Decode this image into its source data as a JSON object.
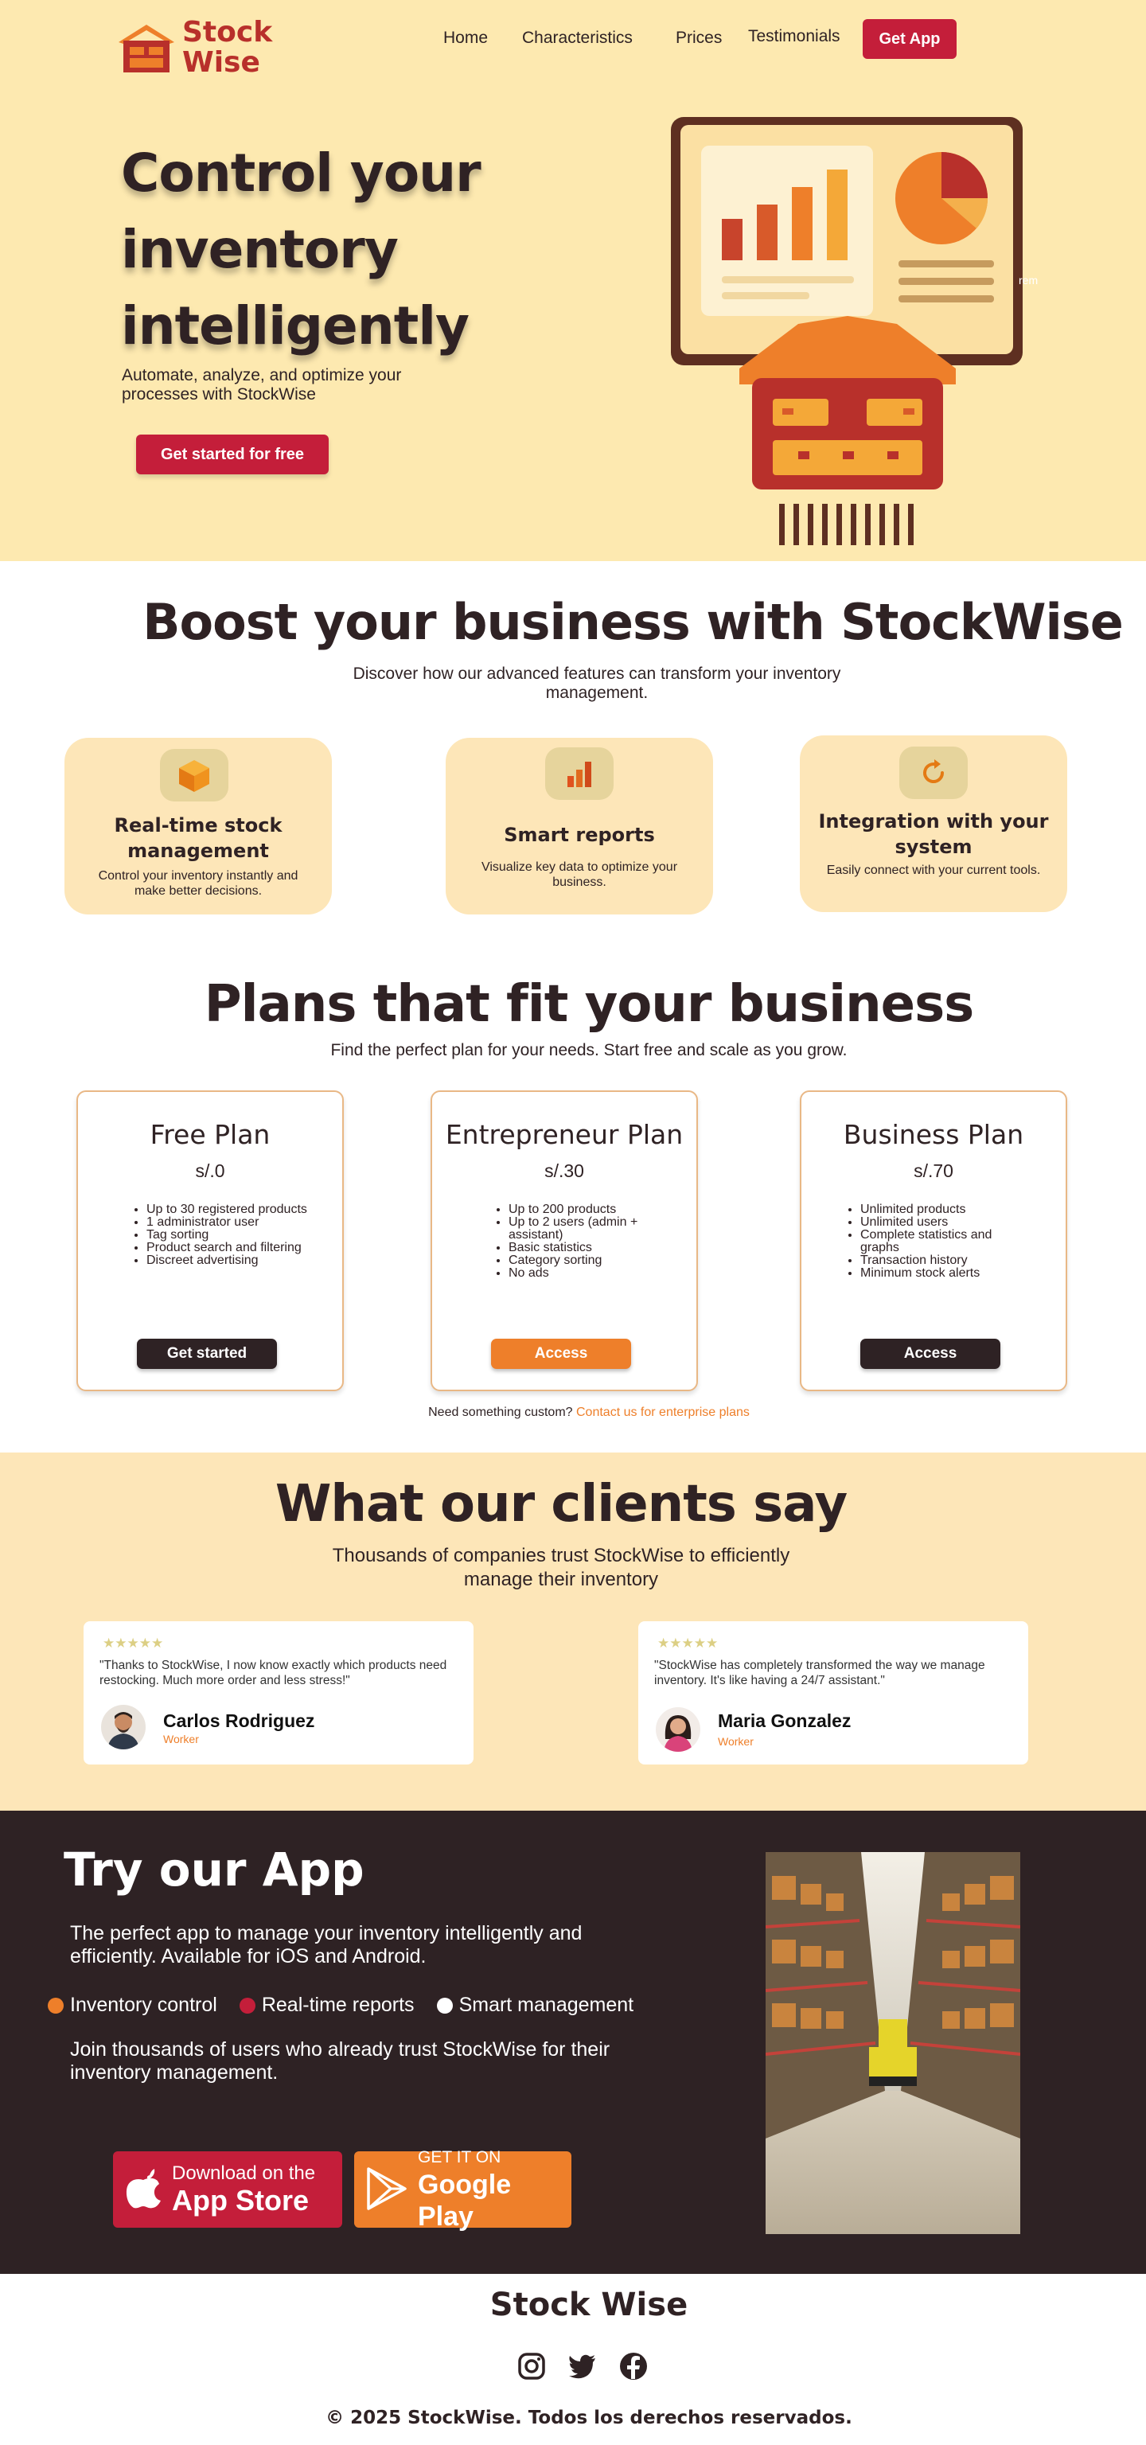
{
  "brand": {
    "name_line1": "Stock",
    "name_line2": "Wise"
  },
  "nav": {
    "home": "Home",
    "characteristics": "Characteristics",
    "prices": "Prices",
    "testimonials": "Testimonials",
    "get_app": "Get App"
  },
  "hero": {
    "title": "Control your inventory intelligently",
    "subtitle": "Automate, analyze, and optimize your processes with StockWise",
    "cta": "Get started for free",
    "caption": "rem"
  },
  "features": {
    "title": "Boost your business with StockWise",
    "subtitle": "Discover how our advanced features can transform your inventory management.",
    "items": [
      {
        "icon": "cube-icon",
        "title": "Real-time stock management",
        "desc": "Control your inventory instantly and make better decisions."
      },
      {
        "icon": "bar-chart-icon",
        "title": "Smart reports",
        "desc": "Visualize key data to optimize your business."
      },
      {
        "icon": "sync-icon",
        "title": "Integration with your system",
        "desc": "Easily connect with your current tools."
      }
    ]
  },
  "pricing": {
    "title": "Plans that fit your business",
    "subtitle": "Find the perfect plan for your needs. Start free and scale as you grow.",
    "plans": [
      {
        "name": "Free Plan",
        "price": "s/.0",
        "features": [
          "Up to 30 registered products",
          "1 administrator user",
          "Tag sorting",
          "Product search and filtering",
          "Discreet advertising"
        ],
        "button": "Get started",
        "button_color": "#2e2224"
      },
      {
        "name": "Entrepreneur Plan",
        "price": "s/.30",
        "features": [
          "Up to 200 products",
          "Up to 2 users (admin + assistant)",
          "Basic statistics",
          "Category sorting",
          "No ads"
        ],
        "button": "Access",
        "button_color": "#ee7f2a"
      },
      {
        "name": "Business Plan",
        "price": "s/.70",
        "features": [
          "Unlimited products",
          "Unlimited users",
          "Complete statistics and graphs",
          "Transaction history",
          "Minimum stock alerts"
        ],
        "button": "Access",
        "button_color": "#2e2224"
      }
    ],
    "custom_text": "Need something custom?",
    "custom_link": "Contact us for enterprise plans"
  },
  "testimonials": {
    "title": "What our clients say",
    "subtitle": "Thousands of companies trust StockWise to efficiently manage their inventory",
    "items": [
      {
        "stars": "★★★★★",
        "quote": "\"Thanks to StockWise, I now know exactly which products need restocking. Much more order and less stress!\"",
        "name": "Carlos Rodriguez",
        "role": "Worker"
      },
      {
        "stars": "★★★★★",
        "quote": "\"StockWise has completely transformed the way we manage inventory. It's like having a 24/7 assistant.\"",
        "name": "Maria Gonzalez",
        "role": "Worker"
      }
    ]
  },
  "app": {
    "title": "Try our App",
    "description": "The perfect app to manage your inventory intelligently and efficiently. Available for iOS and Android.",
    "points": [
      {
        "label": "Inventory control",
        "color": "#ee7f2a"
      },
      {
        "label": "Real-time reports",
        "color": "#c41e3a"
      },
      {
        "label": "Smart management",
        "color": "#ffffff"
      }
    ],
    "join": "Join thousands of users who already trust StockWise for their inventory management.",
    "appstore": {
      "small": "Download on the",
      "big": "App Store"
    },
    "googleplay": {
      "small": "GET IT ON",
      "big": "Google Play"
    }
  },
  "footer": {
    "brand": "Stock Wise",
    "socials": [
      "instagram-icon",
      "twitter-icon",
      "facebook-icon"
    ],
    "copyright": "© 2025 StockWise. Todos los derechos reservados."
  },
  "colors": {
    "accent": "#c41e3a",
    "orange": "#ee7f2a",
    "dark": "#2e2224",
    "cream": "#fde9b0"
  }
}
